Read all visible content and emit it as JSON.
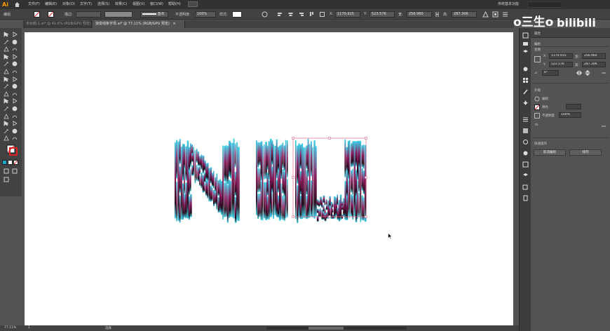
{
  "app": {
    "logo": "Ai"
  },
  "menu": {
    "items": [
      "文件(F)",
      "编辑(E)",
      "对象(O)",
      "文字(T)",
      "选择(S)",
      "效果(C)",
      "视图(V)",
      "窗口(W)",
      "帮助(H)"
    ],
    "workspace": "传统基本功能"
  },
  "control": {
    "group_label": "编组",
    "stroke_label": "描边:",
    "stroke_style": "基本",
    "opacity_label": "不透明度:",
    "opacity_value": "100%",
    "style_label": "样式:",
    "x_value": "1170.915",
    "y_value": "523.576",
    "w_value": "256.960",
    "h_value": "287.306"
  },
  "tabs": [
    {
      "label": "未标题-1.ai* @ 41.6% (RGB/GPU 预览)",
      "close": "×",
      "active": false
    },
    {
      "label": "渐变线条字母.ai* @ 77.11% (RGB/GPU 预览)",
      "close": "×",
      "active": true
    }
  ],
  "status": {
    "zoom": "77.11%",
    "page": "1",
    "tool": "选择"
  },
  "properties": {
    "title": "属性",
    "group_label": "编组",
    "transform_label": "变换",
    "x_label": "X:",
    "x_value": "1170.915",
    "y_label": "Y:",
    "y_value": "523.576",
    "w_label": "宽:",
    "w_value": "256.960",
    "h_label": "高:",
    "h_value": "287.306",
    "angle_label": "⊿:",
    "angle_value": "0°",
    "appearance_label": "外观",
    "fill_label": "填色",
    "stroke_label": "描边",
    "opacity_label": "不透明度",
    "opacity_value": "100%",
    "fx_label": "fx.",
    "quick_actions_label": "快速操作",
    "ungroup_label": "取消编组",
    "arrange_label": "排列"
  },
  "watermark": {
    "text": "o三生o",
    "logo": "bilibili"
  },
  "colors": {
    "accent": "#ff9a00",
    "cyan": "#3ad2e8",
    "magenta": "#8a1a5c",
    "selection": "#e86a8a"
  }
}
